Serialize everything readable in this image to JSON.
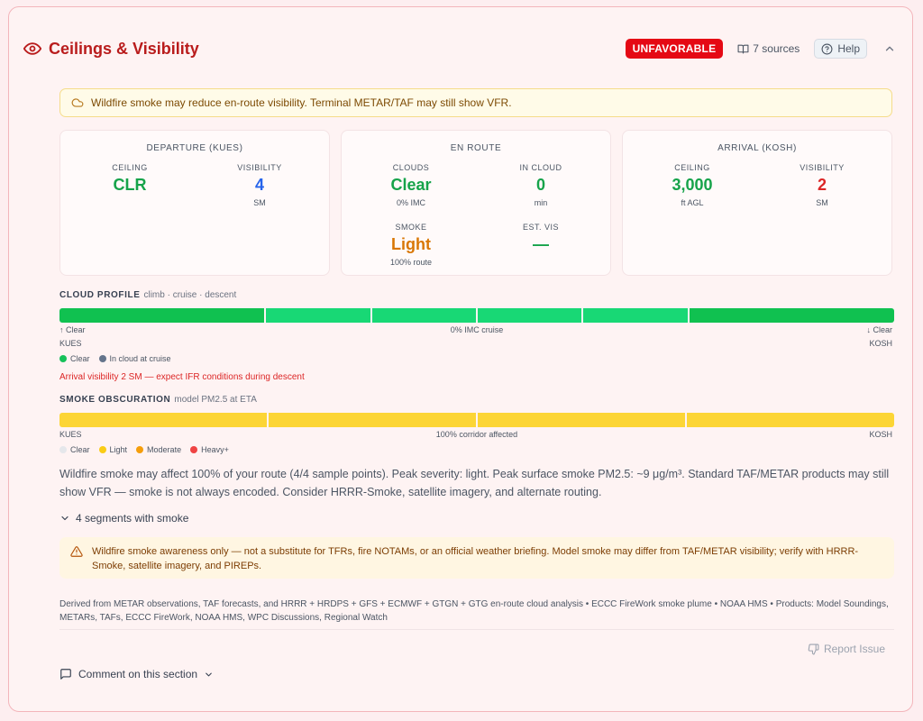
{
  "header": {
    "title": "Ceilings & Visibility",
    "status_badge": "UNFAVORABLE",
    "sources_label": "7 sources",
    "help_label": "Help"
  },
  "alert": {
    "text": "Wildfire smoke may reduce en-route visibility. Terminal METAR/TAF may still show VFR."
  },
  "panels": {
    "departure": {
      "title": "DEPARTURE (KUES)",
      "ceiling_label": "CEILING",
      "ceiling_value": "CLR",
      "visibility_label": "VISIBILITY",
      "visibility_value": "4",
      "visibility_unit": "SM"
    },
    "enroute": {
      "title": "EN ROUTE",
      "clouds_label": "CLOUDS",
      "clouds_value": "Clear",
      "clouds_sub": "0% IMC",
      "incloud_label": "IN CLOUD",
      "incloud_value": "0",
      "incloud_unit": "min",
      "smoke_label": "SMOKE",
      "smoke_value": "Light",
      "smoke_sub": "100% route",
      "estvis_label": "EST. VIS",
      "estvis_value": "—"
    },
    "arrival": {
      "title": "ARRIVAL (KOSH)",
      "ceiling_label": "CEILING",
      "ceiling_value": "3,000",
      "ceiling_unit": "ft AGL",
      "visibility_label": "VISIBILITY",
      "visibility_value": "2",
      "visibility_unit": "SM"
    }
  },
  "cloud_profile": {
    "title": "CLOUD PROFILE",
    "subtitle": "climb · cruise · descent",
    "segment_colors": [
      "#10c150",
      "#18d875",
      "#18d875",
      "#18d875",
      "#18d875",
      "#10c150"
    ],
    "segment_weights": [
      0.248,
      0.126,
      0.126,
      0.126,
      0.126,
      0.248
    ],
    "left_note": "↑ Clear",
    "center_note": "0% IMC cruise",
    "right_note": "↓ Clear",
    "from": "KUES",
    "to": "KOSH",
    "legend": [
      {
        "label": "Clear",
        "color": "#16c15a"
      },
      {
        "label": "In cloud at cruise",
        "color": "#64748b"
      }
    ],
    "warning": "Arrival visibility 2 SM — expect IFR conditions during descent"
  },
  "smoke": {
    "title": "SMOKE OBSCURATION",
    "subtitle": "model PM2.5 at ETA",
    "segment_colors": [
      "#fcd535",
      "#fcd535",
      "#fcd535",
      "#fcd535"
    ],
    "from": "KUES",
    "center_note": "100% corridor affected",
    "to": "KOSH",
    "legend": [
      {
        "label": "Clear",
        "color": "#e5e7eb"
      },
      {
        "label": "Light",
        "color": "#facc15"
      },
      {
        "label": "Moderate",
        "color": "#f59e0b"
      },
      {
        "label": "Heavy+",
        "color": "#ef4444"
      }
    ]
  },
  "summary": "Wildfire smoke may affect 100% of your route (4/4 sample points). Peak severity: light. Peak surface smoke PM2.5: ~9 μg/m³. Standard TAF/METAR products may still show VFR — smoke is not always encoded. Consider HRRR-Smoke, satellite imagery, and alternate routing.",
  "segments_toggle": "4 segments with smoke",
  "notice": "Wildfire smoke awareness only — not a substitute for TFRs, fire NOTAMs, or an official weather briefing. Model smoke may differ from TAF/METAR visibility; verify with HRRR-Smoke, satellite imagery, and PIREPs.",
  "sources_text": "Derived from METAR observations, TAF forecasts, and HRRR + HRDPS + GFS + ECMWF + GTGN + GTG en-route cloud analysis • ECCC FireWork smoke plume • NOAA HMS • Products: Model Soundings, METARs, TAFs, ECCC FireWork, NOAA HMS, WPC Discussions, Regional Watch",
  "report_label": "Report Issue",
  "comment_label": "Comment on this section"
}
